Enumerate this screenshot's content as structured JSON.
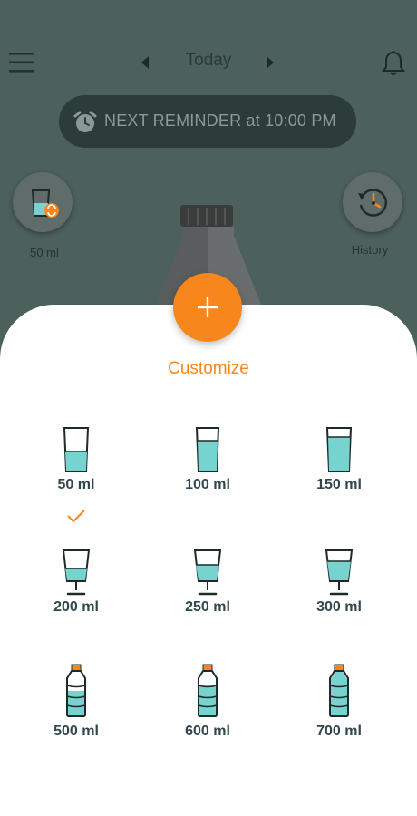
{
  "header": {
    "date_label": "Today",
    "reminder_text": "NEXT REMINDER at 10:00 PM"
  },
  "side": {
    "cup_label": "50 ml",
    "history_label": "History"
  },
  "sheet": {
    "title": "Customize",
    "options": [
      {
        "label": "50 ml",
        "kind": "glass",
        "selected": true
      },
      {
        "label": "100 ml",
        "kind": "glass",
        "selected": false
      },
      {
        "label": "150 ml",
        "kind": "glass",
        "selected": false
      },
      {
        "label": "200 ml",
        "kind": "goblet",
        "selected": false
      },
      {
        "label": "250 ml",
        "kind": "goblet",
        "selected": false
      },
      {
        "label": "300 ml",
        "kind": "goblet",
        "selected": false
      },
      {
        "label": "500 ml",
        "kind": "bottle",
        "selected": false
      },
      {
        "label": "600 ml",
        "kind": "bottle",
        "selected": false
      },
      {
        "label": "700 ml",
        "kind": "bottle",
        "selected": false
      }
    ]
  },
  "colors": {
    "accent": "#f7861c",
    "header_bg": "#4c605c",
    "water": "#76d3cf",
    "label": "#31474e"
  },
  "icons": [
    "menu-icon",
    "chevron-left-icon",
    "chevron-right-icon",
    "bell-icon",
    "alarm-clock-icon",
    "cup-switch-icon",
    "history-clock-icon",
    "plus-icon",
    "checkmark-icon"
  ]
}
